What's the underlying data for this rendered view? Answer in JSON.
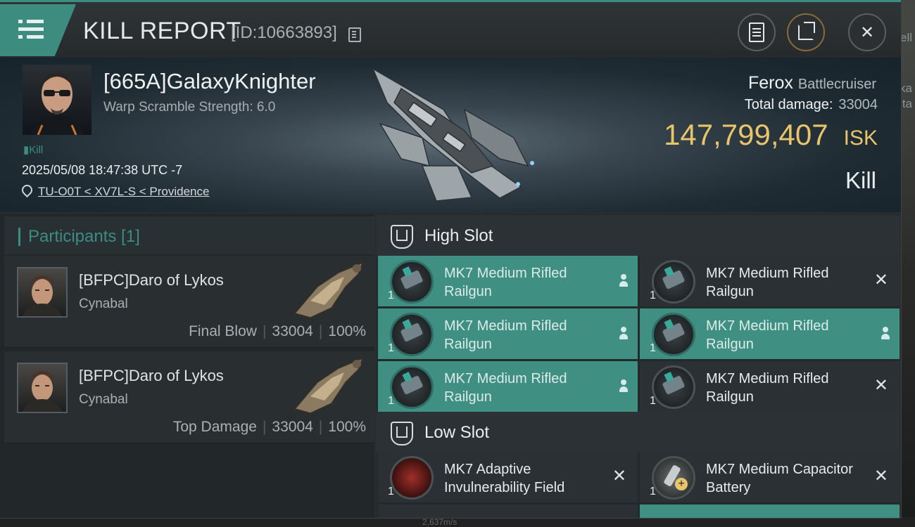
{
  "window": {
    "title": "KILL REPORT",
    "report_id": "[ID:10663893]",
    "accent_color": "#3d8c80",
    "gold_color": "#e8c46a"
  },
  "toolbar": {
    "clipboard_icon": "clipboard-icon",
    "share_icon": "share-icon",
    "close_icon": "close-icon"
  },
  "victim": {
    "name": "[665A]GalaxyKnighter",
    "warp_scramble": "Warp Scramble Strength: 6.0",
    "tag": "Kill",
    "datetime": "2025/05/08 18:47:38 UTC -7",
    "location": "TU-O0T < XV7L-S < Providence",
    "ship": "Ferox",
    "ship_class": "Battlecruiser",
    "total_damage_label": "Total damage:",
    "total_damage": "33004",
    "isk_value": "147,799,407",
    "isk_unit": "ISK",
    "result": "Kill"
  },
  "participants": {
    "header": "Participants [1]",
    "rows": [
      {
        "name": "[BFPC]Daro of Lykos",
        "ship": "Cynabal",
        "role": "Final Blow",
        "damage": "33004",
        "percent": "100%"
      },
      {
        "name": "[BFPC]Daro of Lykos",
        "ship": "Cynabal",
        "role": "Top Damage",
        "damage": "33004",
        "percent": "100%"
      }
    ]
  },
  "slots": {
    "high_slot_label": "High Slot",
    "low_slot_label": "Low Slot",
    "high": [
      {
        "name": "MK7 Medium Rifled Railgun",
        "qty": "1",
        "status": "dropped"
      },
      {
        "name": "MK7 Medium Rifled Railgun",
        "qty": "1",
        "status": "destroyed"
      },
      {
        "name": "MK7 Medium Rifled Railgun",
        "qty": "1",
        "status": "dropped"
      },
      {
        "name": "MK7 Medium Rifled Railgun",
        "qty": "1",
        "status": "dropped"
      },
      {
        "name": "MK7 Medium Rifled Railgun",
        "qty": "1",
        "status": "dropped"
      },
      {
        "name": "MK7 Medium Rifled Railgun",
        "qty": "1",
        "status": "destroyed"
      }
    ],
    "low": [
      {
        "name": "MK7 Adaptive Invulnerability Field",
        "qty": "1",
        "status": "destroyed"
      },
      {
        "name": "MK7 Medium Capacitor Battery",
        "qty": "1",
        "status": "destroyed"
      }
    ]
  },
  "background": {
    "right_text_1": "ell",
    "right_text_2": "ka",
    "right_text_3": "nta",
    "speed": "2,637m/s"
  }
}
